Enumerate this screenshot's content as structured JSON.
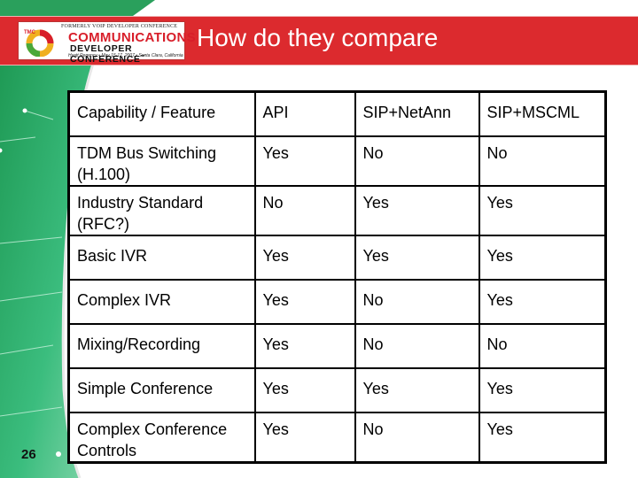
{
  "slide": {
    "title": "How do they compare",
    "page_number": "26"
  },
  "logo": {
    "tagline": "FORMERLY VOIP DEVELOPER CONFERENCE",
    "line1": "COMMUNICATIONS",
    "line2": "DEVELOPER CONFERENCE",
    "trademark": "™",
    "subline": "Hyatt Regency • May 15-17, 2007 • Santa Clara, California",
    "emblem_text": "TMC"
  },
  "colors": {
    "title_bar": "#dc2a2e",
    "background_accent": "#2fae6a",
    "logo_red": "#d81e2a"
  },
  "table": {
    "headers": [
      "Capability / Feature",
      "API",
      "SIP+NetAnn",
      "SIP+MSCML"
    ],
    "rows": [
      {
        "feature": "TDM Bus Switching (H.100)",
        "api": "Yes",
        "netann": "No",
        "mscml": "No"
      },
      {
        "feature": "Industry Standard (RFC?)",
        "api": "No",
        "netann": "Yes",
        "mscml": "Yes"
      },
      {
        "feature": "Basic IVR",
        "api": "Yes",
        "netann": "Yes",
        "mscml": "Yes"
      },
      {
        "feature": "Complex IVR",
        "api": "Yes",
        "netann": "No",
        "mscml": "Yes"
      },
      {
        "feature": "Mixing/Recording",
        "api": "Yes",
        "netann": "No",
        "mscml": "No"
      },
      {
        "feature": "Simple Conference",
        "api": "Yes",
        "netann": "Yes",
        "mscml": "Yes"
      },
      {
        "feature": "Complex Conference Controls",
        "api": "Yes",
        "netann": "No",
        "mscml": "Yes"
      }
    ]
  }
}
